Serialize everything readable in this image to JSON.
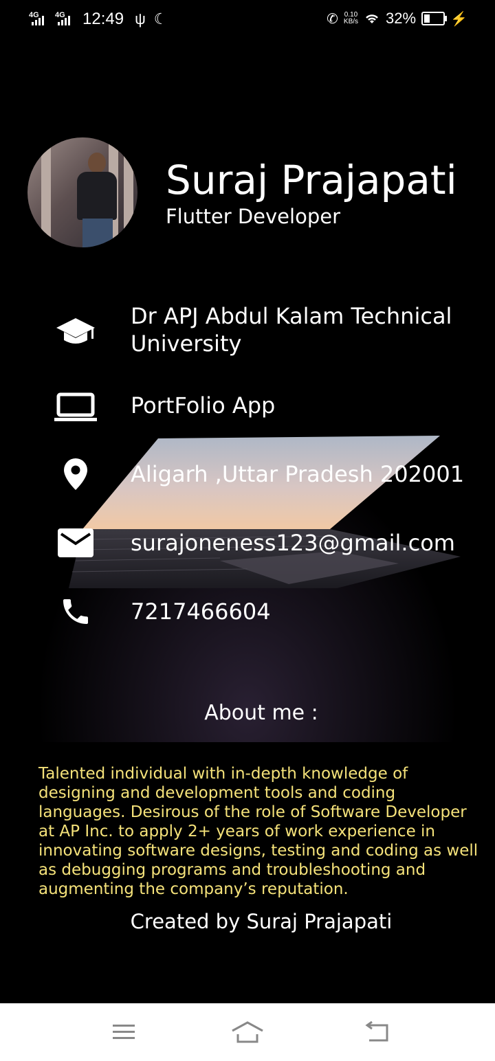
{
  "status_bar": {
    "signal1": "4G",
    "signal2": "4G",
    "time": "12:49",
    "speed_value": "0.10",
    "speed_unit": "KB/s",
    "battery": "32%",
    "battery_level": 0.32
  },
  "profile": {
    "name": "Suraj Prajapati",
    "role": "Flutter Developer"
  },
  "info": [
    {
      "icon": "graduation-cap-icon",
      "text": "Dr APJ Abdul Kalam Technical University"
    },
    {
      "icon": "laptop-icon",
      "text": "PortFolio App"
    },
    {
      "icon": "location-pin-icon",
      "text": "Aligarh ,Uttar Pradesh 202001"
    },
    {
      "icon": "email-icon",
      "text": "surajoneness123@gmail.com"
    },
    {
      "icon": "phone-icon",
      "text": "7217466604"
    }
  ],
  "about": {
    "title": "About me :",
    "text": "Talented individual with in-depth knowledge of designing and development tools and coding languages. Desirous of the role of Software Developer at AP Inc. to apply 2+ years of work experience in innovating software designs, testing and coding as well as debugging programs and troubleshooting and augmenting the company’s reputation."
  },
  "footer": {
    "credit": "Created by Suraj Prajapati"
  },
  "colors": {
    "background": "#000000",
    "about_text": "#f5e27a",
    "nav_bar": "#ffffff"
  }
}
